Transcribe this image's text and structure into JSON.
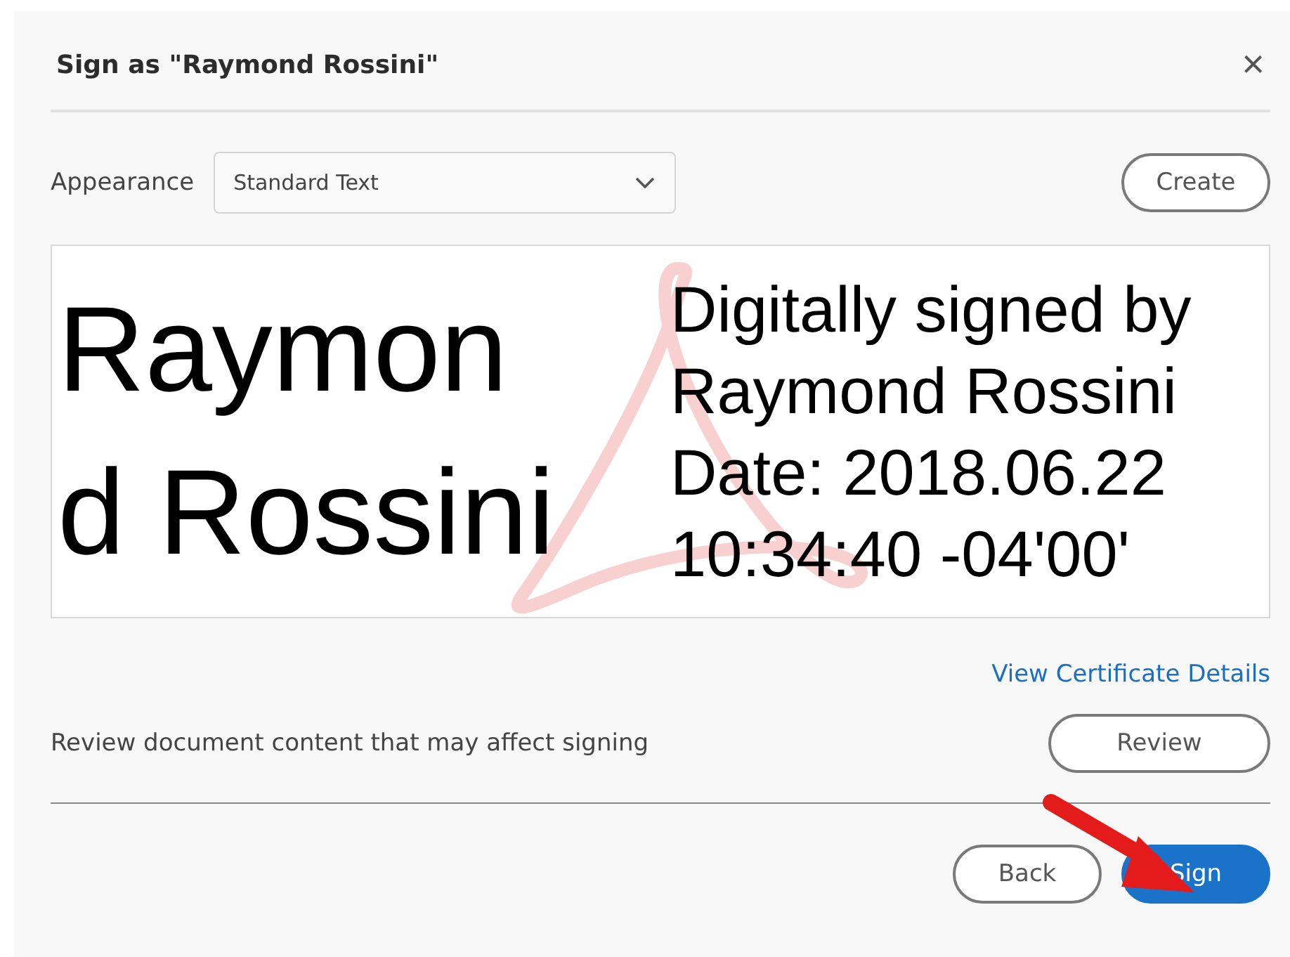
{
  "dialog": {
    "title": "Sign as \"Raymond Rossini\"",
    "close": "×"
  },
  "appearance": {
    "label": "Appearance",
    "value": "Standard Text",
    "create": "Create"
  },
  "preview": {
    "name_lines": [
      "Raymon",
      "d Rossini"
    ],
    "details": [
      "Digitally signed by",
      "Raymond Rossini",
      "Date: 2018.06.22",
      "10:34:40 -04'00'"
    ]
  },
  "certificate_link": "View Certificate Details",
  "review": {
    "text": "Review document content that may affect signing",
    "button": "Review"
  },
  "buttons": [
    {
      "label": "Back",
      "kind": "secondary"
    },
    {
      "label": "Sign",
      "kind": "primary"
    }
  ],
  "annotation": {
    "kind": "arrow"
  }
}
